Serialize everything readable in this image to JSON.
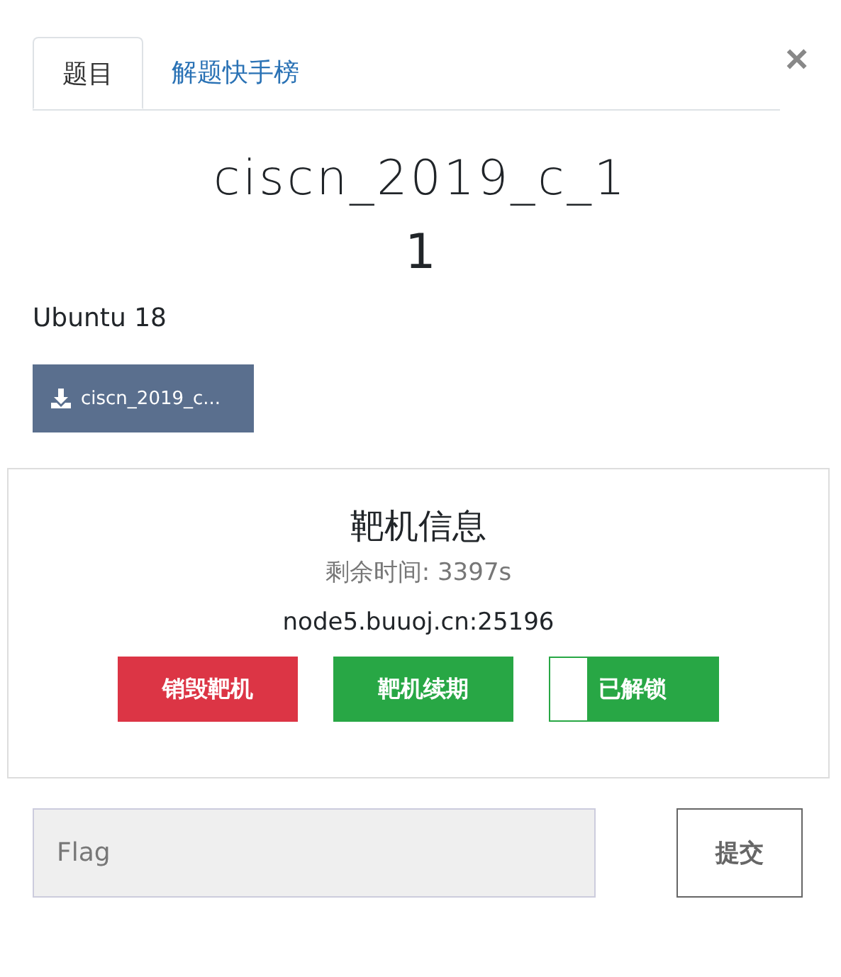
{
  "tabs": [
    {
      "label": "题目",
      "selected": true
    },
    {
      "label": "解题快手榜",
      "selected": false
    }
  ],
  "close": "×",
  "challenge": {
    "name": "ciscn_2019_c_1",
    "value": "1",
    "description": "Ubuntu 18",
    "file": "ciscn_2019_c..."
  },
  "instance": {
    "title": "靶机信息",
    "remaining": "剩余时间: 3397s",
    "host": "node5.buuoj.cn:25196",
    "buttons": [
      {
        "label": "销毁靶机",
        "kind": "danger"
      },
      {
        "label": "靶机续期",
        "kind": "success"
      },
      {
        "label": "已解锁",
        "kind": "unlocked"
      }
    ]
  },
  "flag": {
    "placeholder": "Flag"
  },
  "submit": "提交"
}
